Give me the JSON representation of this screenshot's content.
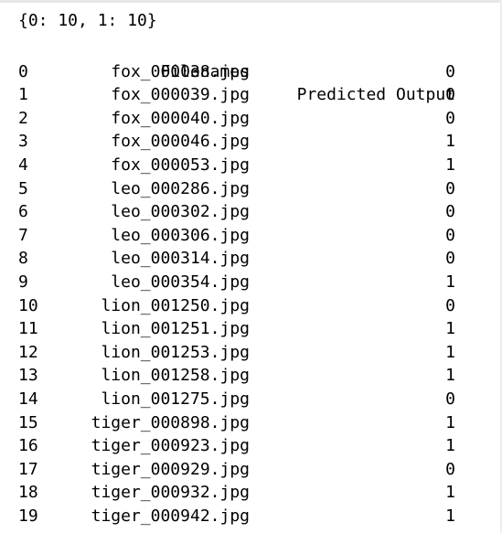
{
  "output": {
    "dict_line": "{0: 10, 1: 10}",
    "columns": {
      "filenames": "Filenames",
      "predicted": "Predicted Output"
    },
    "rows": [
      {
        "index": "0",
        "filename": "fox_000038.jpg",
        "predicted": "0"
      },
      {
        "index": "1",
        "filename": "fox_000039.jpg",
        "predicted": "0"
      },
      {
        "index": "2",
        "filename": "fox_000040.jpg",
        "predicted": "0"
      },
      {
        "index": "3",
        "filename": "fox_000046.jpg",
        "predicted": "1"
      },
      {
        "index": "4",
        "filename": "fox_000053.jpg",
        "predicted": "1"
      },
      {
        "index": "5",
        "filename": "leo_000286.jpg",
        "predicted": "0"
      },
      {
        "index": "6",
        "filename": "leo_000302.jpg",
        "predicted": "0"
      },
      {
        "index": "7",
        "filename": "leo_000306.jpg",
        "predicted": "0"
      },
      {
        "index": "8",
        "filename": "leo_000314.jpg",
        "predicted": "0"
      },
      {
        "index": "9",
        "filename": "leo_000354.jpg",
        "predicted": "1"
      },
      {
        "index": "10",
        "filename": "lion_001250.jpg",
        "predicted": "0"
      },
      {
        "index": "11",
        "filename": "lion_001251.jpg",
        "predicted": "1"
      },
      {
        "index": "12",
        "filename": "lion_001253.jpg",
        "predicted": "1"
      },
      {
        "index": "13",
        "filename": "lion_001258.jpg",
        "predicted": "1"
      },
      {
        "index": "14",
        "filename": "lion_001275.jpg",
        "predicted": "0"
      },
      {
        "index": "15",
        "filename": "tiger_000898.jpg",
        "predicted": "1"
      },
      {
        "index": "16",
        "filename": "tiger_000923.jpg",
        "predicted": "1"
      },
      {
        "index": "17",
        "filename": "tiger_000929.jpg",
        "predicted": "0"
      },
      {
        "index": "18",
        "filename": "tiger_000932.jpg",
        "predicted": "1"
      },
      {
        "index": "19",
        "filename": "tiger_000942.jpg",
        "predicted": "1"
      }
    ]
  }
}
